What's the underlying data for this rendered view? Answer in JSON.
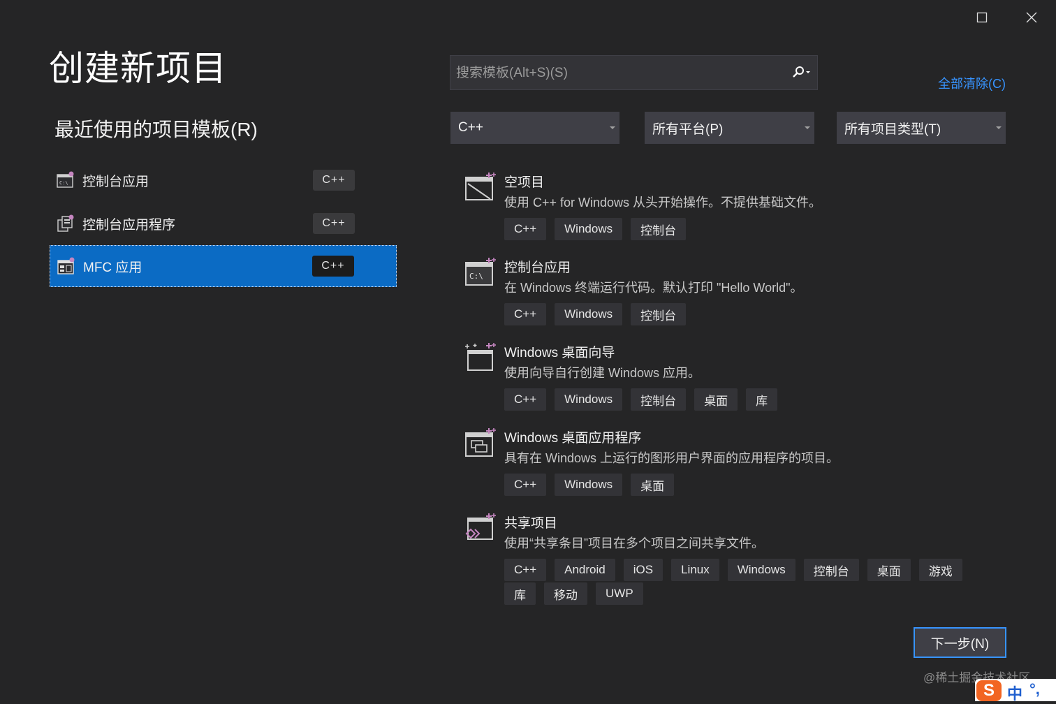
{
  "window": {
    "maximize_icon": "maximize-icon",
    "close_icon": "close-icon"
  },
  "title": "创建新项目",
  "recent": {
    "title": "最近使用的项目模板(R)",
    "items": [
      {
        "label": "控制台应用",
        "lang": "C++",
        "selected": false
      },
      {
        "label": "控制台应用程序",
        "lang": "C++",
        "selected": false
      },
      {
        "label": "MFC 应用",
        "lang": "C++",
        "selected": true
      }
    ]
  },
  "search": {
    "placeholder": "搜索模板(Alt+S)(S)",
    "value": ""
  },
  "clear_all": "全部清除(C)",
  "filters": {
    "language": "C++",
    "platform": "所有平台(P)",
    "project_type": "所有项目类型(T)"
  },
  "templates": [
    {
      "name": "空项目",
      "desc": "使用 C++ for Windows 从头开始操作。不提供基础文件。",
      "tags": [
        "C++",
        "Windows",
        "控制台"
      ]
    },
    {
      "name": "控制台应用",
      "desc": "在 Windows 终端运行代码。默认打印 \"Hello World\"。",
      "tags": [
        "C++",
        "Windows",
        "控制台"
      ]
    },
    {
      "name": "Windows 桌面向导",
      "desc": "使用向导自行创建 Windows 应用。",
      "tags": [
        "C++",
        "Windows",
        "控制台",
        "桌面",
        "库"
      ]
    },
    {
      "name": "Windows 桌面应用程序",
      "desc": "具有在 Windows 上运行的图形用户界面的应用程序的项目。",
      "tags": [
        "C++",
        "Windows",
        "桌面"
      ]
    },
    {
      "name": "共享项目",
      "desc": "使用“共享条目”项目在多个项目之间共享文件。",
      "tags": [
        "C++",
        "Android",
        "iOS",
        "Linux",
        "Windows",
        "控制台",
        "桌面",
        "游戏",
        "库",
        "移动",
        "UWP"
      ]
    }
  ],
  "next_button": "下一步(N)",
  "watermark": "@稀土掘金技术社区",
  "ime": {
    "logo": "S",
    "mode": "中",
    "punct": "°,"
  },
  "colors": {
    "background": "#252526",
    "accent": "#0b6bc4",
    "link": "#3794ff"
  }
}
